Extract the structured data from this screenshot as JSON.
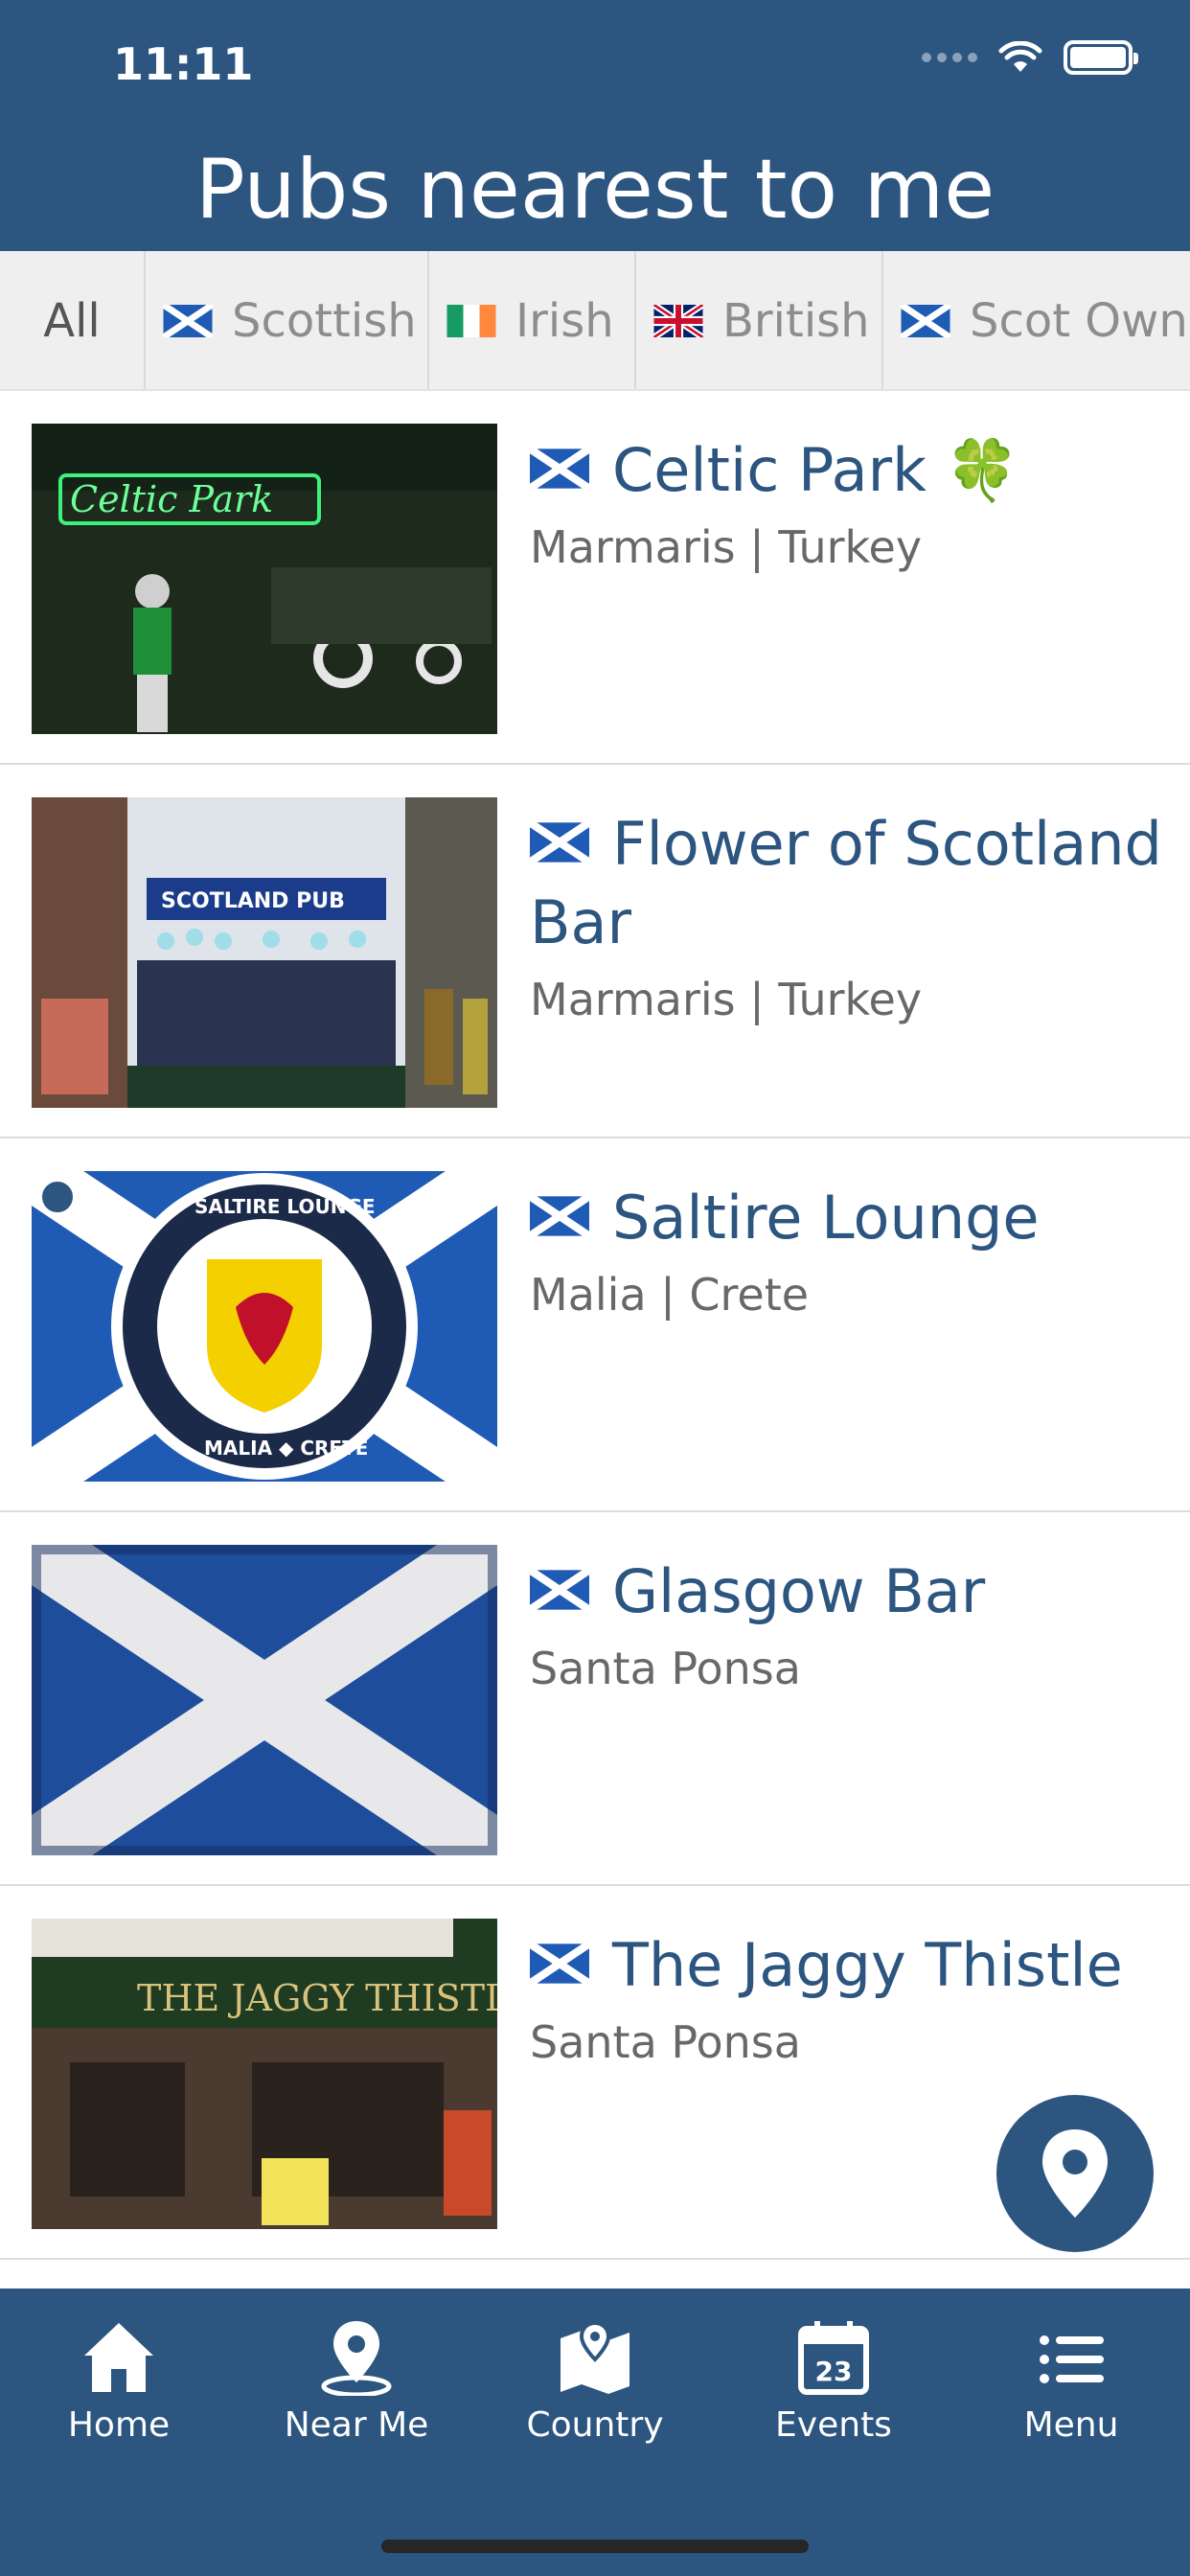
{
  "status_bar": {
    "time": "11:11"
  },
  "header": {
    "title": "Pubs nearest to me"
  },
  "filters": [
    {
      "label": "All",
      "flag": null
    },
    {
      "label": "Scottish",
      "flag": "scotland"
    },
    {
      "label": "Irish",
      "flag": "ireland"
    },
    {
      "label": "British",
      "flag": "uk"
    },
    {
      "label": "Scot Owned",
      "flag": "scotland"
    }
  ],
  "pubs": [
    {
      "name": "Celtic Park",
      "name_suffix": "🍀",
      "location": "Marmaris | Turkey",
      "verified": false
    },
    {
      "name": "Flower of Scotland Bar",
      "location": "Marmaris | Turkey",
      "verified": false
    },
    {
      "name": "Saltire Lounge",
      "location": "Malia | Crete",
      "verified": true
    },
    {
      "name": "Glasgow Bar",
      "location": "Santa Ponsa",
      "verified": false
    },
    {
      "name": "The Jaggy Thistle",
      "location": "Santa Ponsa",
      "verified": false
    }
  ],
  "tabbar": {
    "items": [
      {
        "label": "Home",
        "icon": "home-icon"
      },
      {
        "label": "Near Me",
        "icon": "location-pin-icon"
      },
      {
        "label": "Country",
        "icon": "map-icon"
      },
      {
        "label": "Events",
        "icon": "calendar-icon",
        "icon_text": "23"
      },
      {
        "label": "Menu",
        "icon": "menu-list-icon"
      }
    ]
  },
  "colors": {
    "brand": "#2c5580",
    "filter_bg": "#efefef",
    "location_text": "#686868"
  }
}
